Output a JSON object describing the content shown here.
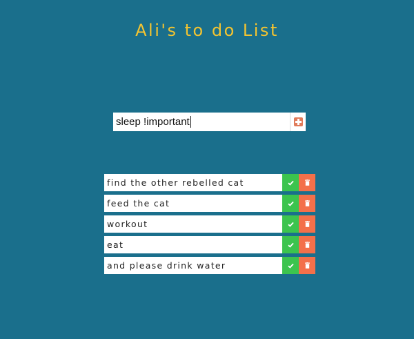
{
  "title": "Ali's to do List",
  "input": {
    "value": "sleep !important",
    "add_icon": "plus-square-icon"
  },
  "todos": [
    {
      "text": "find the other rebelled cat"
    },
    {
      "text": "feed the cat"
    },
    {
      "text": "workout"
    },
    {
      "text": "eat"
    },
    {
      "text": "and please drink water"
    }
  ],
  "icons": {
    "complete": "check-icon",
    "delete": "trash-icon"
  },
  "colors": {
    "background": "#1a6f8c",
    "title": "#f4c430",
    "complete": "#3cc44e",
    "delete": "#f3704a",
    "add": "#e07b5a"
  }
}
